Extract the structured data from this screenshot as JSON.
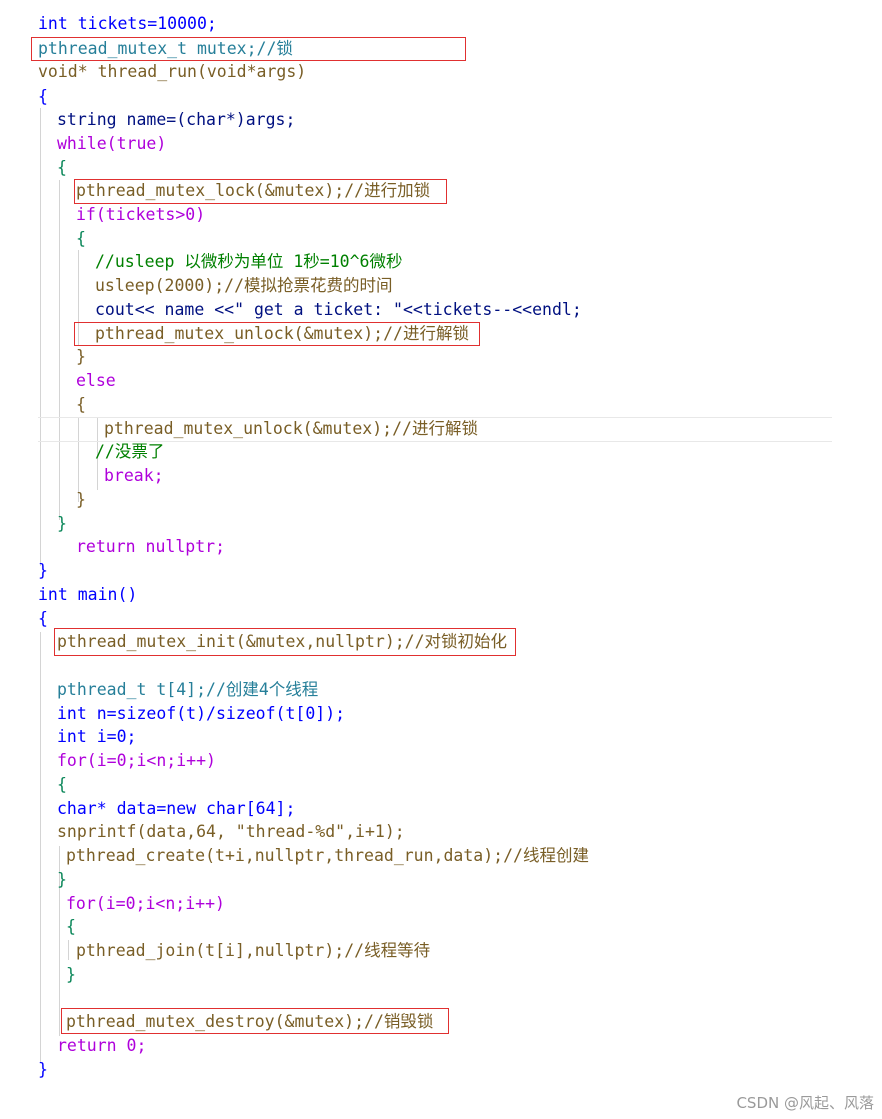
{
  "code": {
    "lines": [
      "int tickets=10000;",
      "pthread_mutex_t mutex;//锁",
      "void* thread_run(void*args)",
      "{",
      "string name=(char*)args;",
      "while(true)",
      "{",
      "pthread_mutex_lock(&mutex);//进行加锁",
      "if(tickets>0)",
      "{",
      "//usleep 以微秒为单位 1秒=10^6微秒",
      "usleep(2000);//模拟抢票花费的时间",
      "cout<< name <<\" get a ticket: \"<<tickets--<<endl;",
      "pthread_mutex_unlock(&mutex);//进行解锁",
      "}",
      "else",
      "{",
      "pthread_mutex_unlock(&mutex);//进行解锁",
      "//没票了",
      "break;",
      "}",
      "}",
      "return nullptr;",
      "}",
      "int main()",
      "{",
      "pthread_mutex_init(&mutex,nullptr);//对锁初始化",
      "",
      "pthread_t t[4];//创建4个线程",
      "int n=sizeof(t)/sizeof(t[0]);",
      "int i=0;",
      "for(i=0;i<n;i++)",
      "{",
      "char* data=new char[64];",
      "snprintf(data,64, \"thread-%d\",i+1);",
      "pthread_create(t+i,nullptr,thread_run,data);//线程创建",
      "}",
      "for(i=0;i<n;i++)",
      "{",
      "pthread_join(t[i],nullptr);//线程等待",
      "}",
      "",
      "pthread_mutex_destroy(&mutex);//销毁锁",
      "return 0;",
      "}"
    ]
  },
  "watermark": "CSDN @风起、风落"
}
